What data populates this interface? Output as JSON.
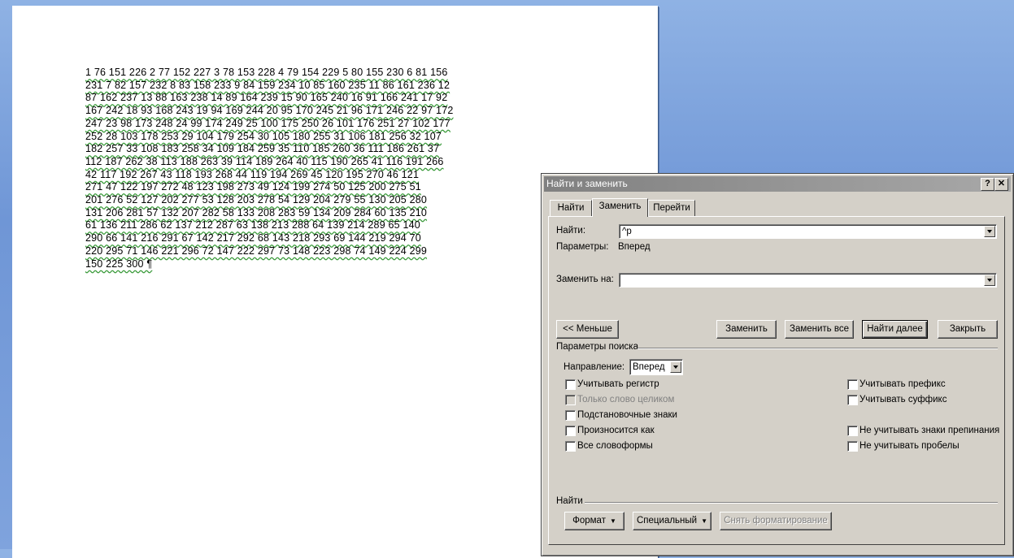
{
  "document": {
    "lines": [
      "1 76 151 226 2 77 152 227 3 78 153 228 4 79 154 229 5 80 155 230 6 81 156",
      "231 7 82 157 232 8 83 158 233 9 84 159 234 10 85 160 235 11 86 161 236 12",
      "87 162 237 13 88 163 238 14 89 164 239 15 90 165 240 16 91 166 241 17 92",
      "167 242 18 93 168 243 19 94 169 244 20 95 170 245 21 96 171 246 22 97 172",
      "247 23 98 173 248 24 99 174 249 25 100 175 250 26 101 176 251 27 102 177",
      "252 28 103 178 253 29 104 179 254 30 105 180 255 31 106 181 256 32 107",
      "182 257 33 108 183 258 34 109 184 259 35 110 185 260 36 111 186 261 37",
      "112 187 262 38 113 188 263 39 114 189 264 40 115 190 265 41 116 191 266",
      "42 117 192 267 43 118 193 268 44 119 194 269 45 120 195 270 46 121",
      "271 47 122 197 272 48 123 198 273 49 124 199 274 50 125 200 275 51",
      "201 276 52 127 202 277 53 128 203 278 54 129 204 279 55 130 205 280",
      "131 206 281 57 132 207 282 58 133 208 283 59 134 209 284 60 135 210",
      "61 136 211 286 62 137 212 287 63 138 213 288 64 139 214 289 65 140",
      "290 66 141 216 291 67 142 217 292 68 143 218 293 69 144 219 294 70",
      "220 295 71 146 221 296 72 147 222 297 73 148 223 298 74 149 224 299",
      "150 225 300 ¶"
    ]
  },
  "dialog": {
    "title": "Найти и заменить",
    "help_glyph": "?",
    "close_glyph": "✕",
    "tabs": [
      "Найти",
      "Заменить",
      "Перейти"
    ],
    "find_label": "Найти:",
    "find_value": "^p",
    "params_label": "Параметры:",
    "params_value": "Вперед",
    "replace_label": "Заменить на:",
    "replace_value": "",
    "buttons": {
      "less": "<< Меньше",
      "replace": "Заменить",
      "replace_all": "Заменить все",
      "find_next": "Найти далее",
      "close": "Закрыть"
    },
    "search_params_title": "Параметры поиска",
    "direction_label": "Направление:",
    "direction_value": "Вперед",
    "options_left": [
      "Учитывать регистр",
      "Только слово целиком",
      "Подстановочные знаки",
      "Произносится как",
      "Все словоформы"
    ],
    "options_right": [
      "Учитывать префикс",
      "Учитывать суффикс",
      "Не учитывать знаки препинания",
      "Не учитывать пробелы"
    ],
    "find_section_title": "Найти",
    "bottom_buttons": {
      "format": "Формат",
      "special": "Специальный",
      "clear_format": "Снять форматирование"
    }
  }
}
